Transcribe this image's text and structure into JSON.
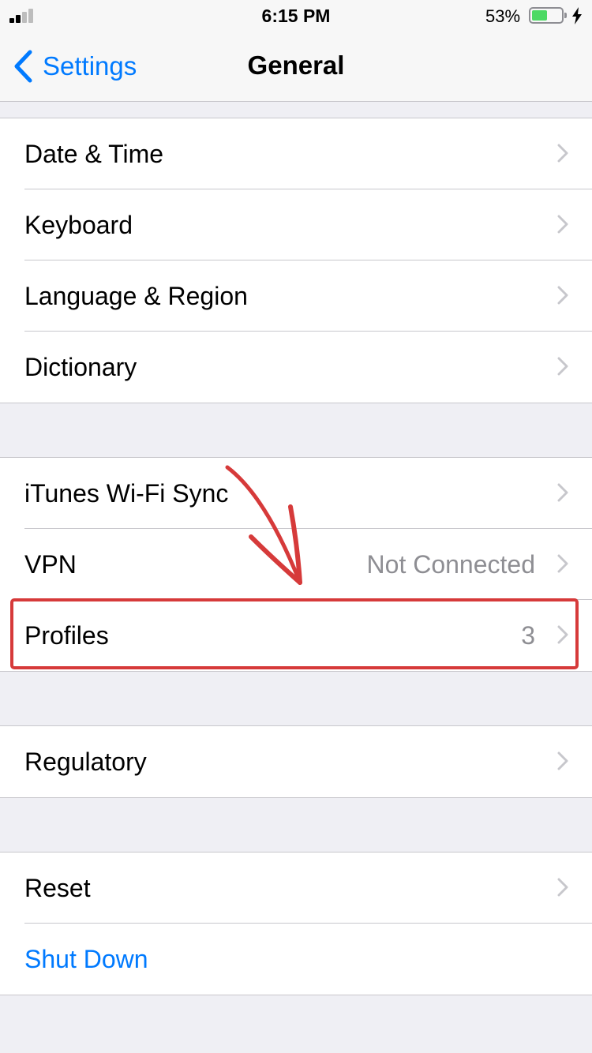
{
  "status_bar": {
    "time": "6:15 PM",
    "battery_percent": "53%",
    "battery_level": 0.53,
    "signal_bars": 2,
    "icons": [
      "signal-icon",
      "battery-icon",
      "charging-bolt-icon"
    ]
  },
  "nav": {
    "back_label": "Settings",
    "title": "General",
    "back_icon": "chevron-left-icon"
  },
  "groups": [
    {
      "rows": [
        {
          "label": "Date & Time"
        },
        {
          "label": "Keyboard"
        },
        {
          "label": "Language & Region"
        },
        {
          "label": "Dictionary"
        }
      ]
    },
    {
      "rows": [
        {
          "label": "iTunes Wi-Fi Sync"
        },
        {
          "label": "VPN",
          "value": "Not Connected"
        },
        {
          "label": "Profiles",
          "value": "3"
        }
      ]
    },
    {
      "rows": [
        {
          "label": "Regulatory"
        }
      ]
    },
    {
      "rows": [
        {
          "label": "Reset"
        },
        {
          "label": "Shut Down"
        }
      ]
    }
  ],
  "colors": {
    "accent": "#007aff",
    "annotation": "#d63a3a",
    "battery_fill": "#4cd964",
    "background": "#efeff4"
  }
}
